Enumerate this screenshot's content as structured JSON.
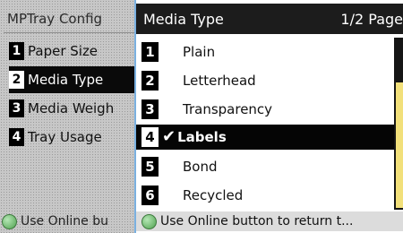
{
  "left_panel": {
    "title": "MPTray Config",
    "items": [
      {
        "num": "1",
        "label": "Paper Size"
      },
      {
        "num": "2",
        "label": "Media Type"
      },
      {
        "num": "3",
        "label": "Media Weigh"
      },
      {
        "num": "4",
        "label": "Tray Usage"
      }
    ],
    "footer_text": "Use Online bu"
  },
  "right_panel": {
    "title": "Media Type",
    "page_indicator": "1/2 Page",
    "items": [
      {
        "num": "1",
        "label": "Plain"
      },
      {
        "num": "2",
        "label": "Letterhead"
      },
      {
        "num": "3",
        "label": "Transparency"
      },
      {
        "num": "4",
        "label": "Labels",
        "check": "✔"
      },
      {
        "num": "5",
        "label": "Bond"
      },
      {
        "num": "6",
        "label": "Recycled"
      }
    ],
    "footer_text": "Use Online button to return t..."
  },
  "icons": {
    "online_button": "green-circle-icon",
    "selected_marker": "checkmark-icon"
  },
  "colors": {
    "selection_background": "#050505",
    "online_button": "#4fa14f",
    "scroll_indicator": "#f2e07a"
  }
}
